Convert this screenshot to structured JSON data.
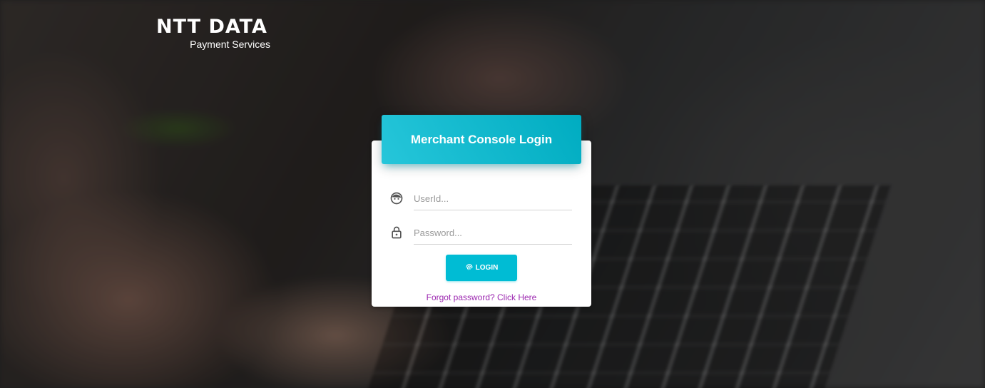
{
  "brand": {
    "name": "NTT DATA",
    "tagline": "Payment Services"
  },
  "login": {
    "title": "Merchant Console Login",
    "userid_placeholder": "UserId...",
    "userid_value": "",
    "password_placeholder": "Password...",
    "password_value": "",
    "button_label": "LOGIN",
    "forgot_link": "Forgot password? Click Here"
  },
  "icons": {
    "userid": "face-icon",
    "password": "lock-icon",
    "button": "fingerprint-icon"
  },
  "colors": {
    "accent": "#00bcd4",
    "header_gradient_start": "#26c6da",
    "header_gradient_end": "#00acc1",
    "link": "#9c27b0",
    "icon": "#555555"
  }
}
